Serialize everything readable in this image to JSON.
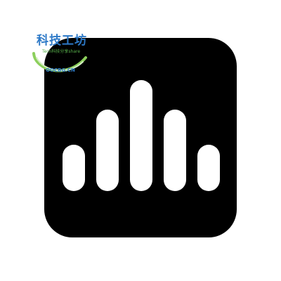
{
  "app_icon": {
    "name": "audio-equalizer-app-icon",
    "background_color": "#000000",
    "bar_color": "#ffffff",
    "bars": [
      {
        "level": 0.26
      },
      {
        "level": 0.56
      },
      {
        "level": 0.76
      },
      {
        "level": 0.56
      },
      {
        "level": 0.26
      }
    ]
  },
  "watermark": {
    "title": "科技工坊",
    "subtitle": "Tech科技分享share",
    "domain": "OOCBG.CN",
    "colors": {
      "title": "#2d79c7",
      "subtitle": "#57b04b",
      "domain": "#2d79c7",
      "swoosh": "#8ccf5c"
    }
  }
}
